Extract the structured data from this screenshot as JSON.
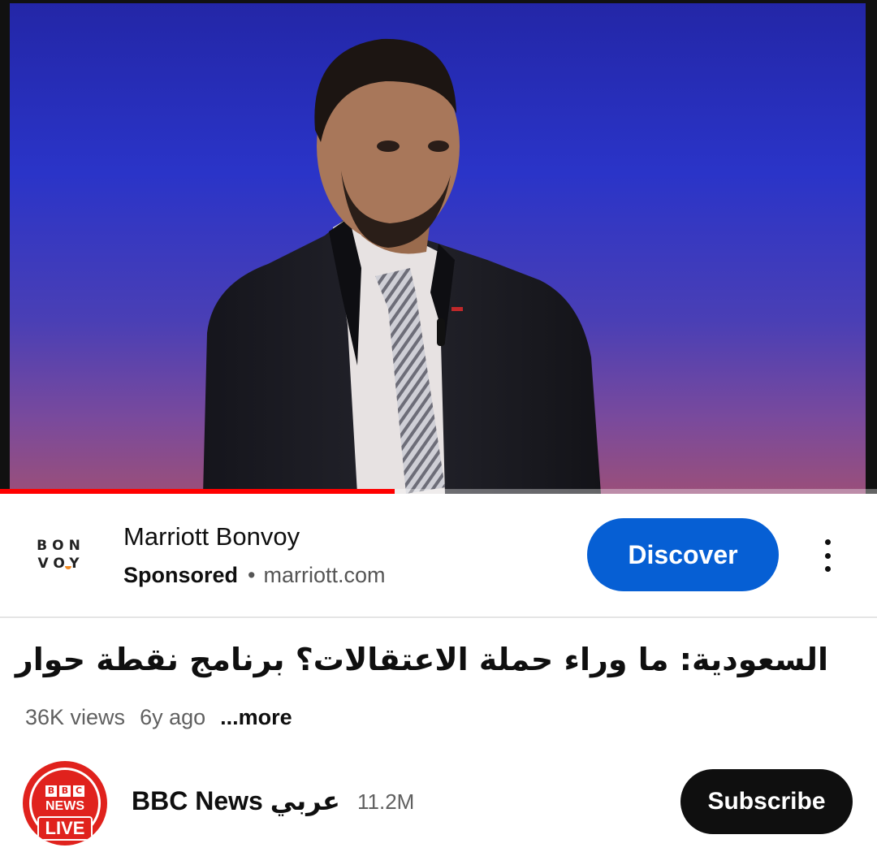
{
  "ad": {
    "logo_line1": "BON",
    "logo_line2": "VOY",
    "advertiser": "Marriott Bonvoy",
    "sponsored_label": "Sponsored",
    "separator": "•",
    "domain": "marriott.com",
    "cta_label": "Discover",
    "more_icon": "more-vert-icon"
  },
  "player": {
    "progress": 0.45,
    "progress_color": "#ff0000"
  },
  "video": {
    "title": "السعودية: ما وراء حملة الاعتقالات؟ برنامج نقطة حوار",
    "views": "36K views",
    "age": "6y ago",
    "more_label": "...more"
  },
  "channel": {
    "avatar_b1": "B",
    "avatar_b2": "B",
    "avatar_b3": "C",
    "avatar_news": "NEWS",
    "avatar_live": "LIVE",
    "name": "BBC News عربي",
    "subscribers": "11.2M",
    "subscribe_label": "Subscribe"
  },
  "colors": {
    "accent_blue": "#065fd4",
    "bbc_red": "#e0221d"
  }
}
